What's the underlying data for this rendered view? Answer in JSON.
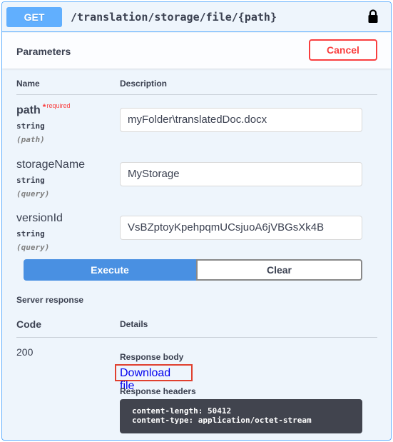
{
  "summary": {
    "method": "GET",
    "path": "/translation/storage/file/{path}",
    "lock_icon": "lock-icon"
  },
  "parameters": {
    "title": "Parameters",
    "cancel_label": "Cancel",
    "col_name": "Name",
    "col_description": "Description",
    "items": [
      {
        "name": "path",
        "required_mark": "*",
        "required_text": "required",
        "type": "string",
        "in": "(path)",
        "value": "myFolder\\translatedDoc.docx"
      },
      {
        "name": "storageName",
        "type": "string",
        "in": "(query)",
        "value": "MyStorage"
      },
      {
        "name": "versionId",
        "type": "string",
        "in": "(query)",
        "value": "VsBZptoyKpehpqmUCsjuoA6jVBGsXk4B"
      }
    ]
  },
  "actions": {
    "execute_label": "Execute",
    "clear_label": "Clear"
  },
  "server_response": {
    "title": "Server response",
    "col_code": "Code",
    "col_details": "Details",
    "code": "200",
    "body_label": "Response body",
    "download_label": "Download file",
    "headers_label": "Response headers",
    "headers": [
      "content-length: 50412",
      "content-type: application/octet-stream"
    ]
  },
  "colors": {
    "get_blue": "#61affe",
    "cancel_red": "#f93e3e",
    "execute_blue": "#4990e2",
    "headers_bg": "#41444e"
  }
}
